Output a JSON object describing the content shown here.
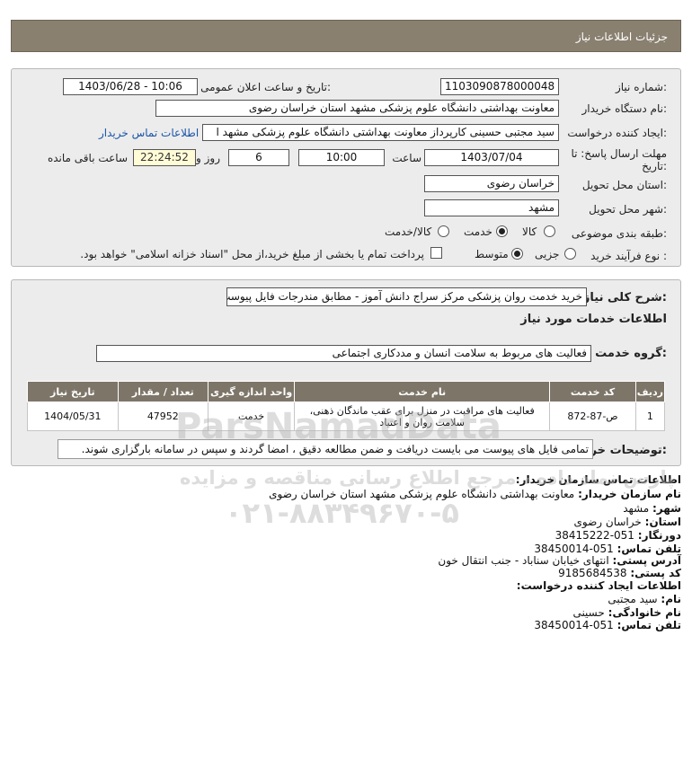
{
  "header": {
    "title": "جزئیات اطلاعات نیاز"
  },
  "form": {
    "need_number_label": "شماره نیاز:",
    "need_number": "1103090878000048",
    "announce_label": "تاریخ و ساعت اعلان عمومی:",
    "announce_value": "1403/06/28 - 10:06",
    "buyer_org_label": "نام دستگاه خریدار:",
    "buyer_org": "معاونت بهداشتی دانشگاه علوم پزشکی مشهد استان خراسان رضوی",
    "creator_label": "ایجاد کننده درخواست:",
    "creator": "سید مجتبی حسینی کارپرداز معاونت بهداشتی دانشگاه علوم پزشکی مشهد ا",
    "contact_link": "اطلاعات تماس خریدار",
    "deadline_label_1": "مهلت ارسال پاسخ: تا",
    "deadline_label_2": "تاریخ:",
    "deadline_date": "1403/07/04",
    "time_label": "ساعت",
    "deadline_time": "10:00",
    "days_value": "6",
    "days_label": "روز و",
    "remaining_time": "22:24:52",
    "remaining_label": "ساعت باقی مانده",
    "province_label": "استان محل تحویل:",
    "province": "خراسان رضوی",
    "city_label": "شهر محل تحویل:",
    "city": "مشهد",
    "category_label": "طبقه بندی موضوعی:",
    "category_options": [
      "کالا",
      "خدمت",
      "کالا/خدمت"
    ],
    "category_selected": "خدمت",
    "process_label": "نوع فرآیند خرید :",
    "process_options": [
      "جزیی",
      "متوسط"
    ],
    "process_selected": "متوسط",
    "payment_note": "پرداخت تمام یا بخشی از مبلغ خرید،از محل \"اسناد خزانه اسلامی\" خواهد بود."
  },
  "description": {
    "label": "شرح کلی نیاز:",
    "value": "خرید خدمت روان پزشکی مرکز سراج دانش آموز - مطابق مندرجات فایل پیوست",
    "services_title": "اطلاعات خدمات مورد نیاز",
    "group_label": "گروه خدمت:",
    "group_value": "فعالیت های مربوط به سلامت انسان و مددکاری اجتماعی"
  },
  "table": {
    "headers": [
      "ردیف",
      "کد خدمت",
      "نام خدمت",
      "واحد اندازه گیری",
      "تعداد / مقدار",
      "تاریخ نیاز"
    ],
    "rows": [
      [
        "1",
        "ص-87-872",
        "فعالیت های مراقبت در منزل برای عقب ماندگان ذهنی، سلامت روان و اعتیاد",
        "خدمت",
        "47952",
        "1404/05/31"
      ]
    ]
  },
  "buyer_notes": {
    "label": "توضیحات خریدار:",
    "value": "تمامی فایل های پیوست می بایست دریافت و ضمن مطالعه دقیق ، امضا گردند و سپس در سامانه بارگزاری شوند."
  },
  "contact": {
    "title": "اطلاعات تماس سازمان خریدار:",
    "org_label": "نام سازمان خریدار:",
    "org": "معاونت بهداشتی دانشگاه علوم پزشکی مشهد استان خراسان رضوی",
    "city_label": "شهر:",
    "city": "مشهد",
    "province_label": "استان:",
    "province": "خراسان رضوی",
    "fax_label": "دورنگار:",
    "fax": "051-38415222",
    "phone_label": "تلفن تماس:",
    "phone": "051-38450014",
    "address_label": "آدرس پستی:",
    "address": "انتهای خیابان سناباد - جنب انتقال خون",
    "postal_label": "کد پستی:",
    "postal": "9185684538",
    "creator_title": "اطلاعات ایجاد کننده درخواست:",
    "name_label": "نام:",
    "name": "سید مجتبی",
    "family_label": "نام خانوادگی:",
    "family": "حسینی",
    "creator_phone_label": "تلفن تماس:",
    "creator_phone": "051-38450014"
  },
  "watermark": {
    "brand": "ParsNamadData",
    "text_fa": "پارس نماد داده ، مرجع اطلاع رسانی مناقصه و مزایده",
    "phone": "۰۲۱-۸۸۳۴۹۶۷۰-۵"
  }
}
